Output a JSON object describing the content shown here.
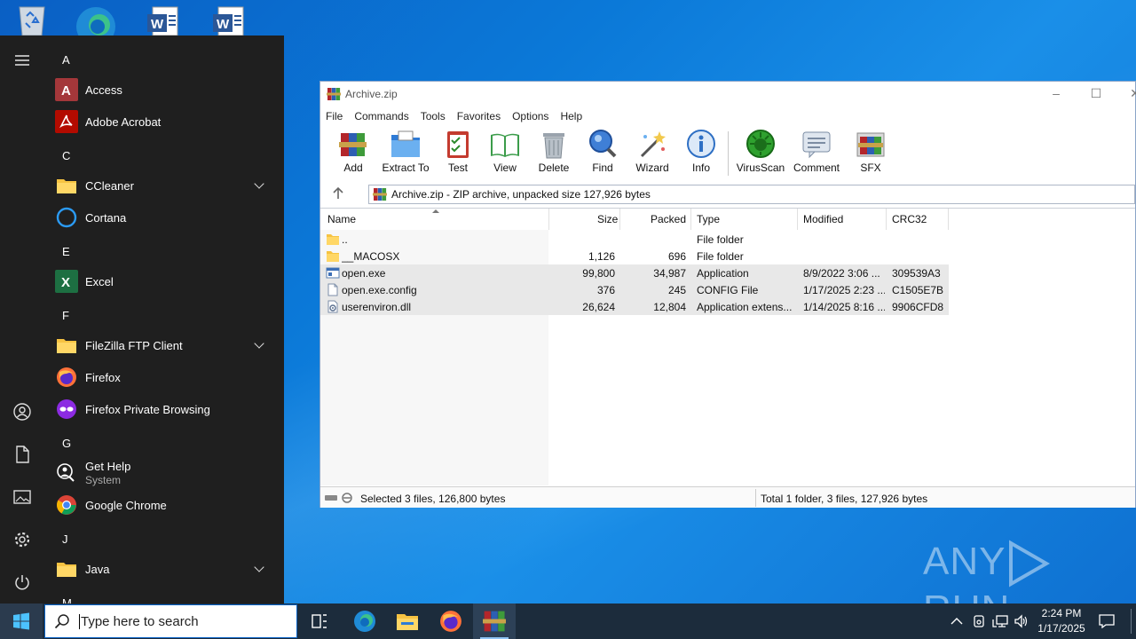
{
  "start_menu": {
    "groups": [
      {
        "letter": "A",
        "apps": [
          {
            "name": "Access",
            "icon": "access-icon"
          },
          {
            "name": "Adobe Acrobat",
            "icon": "acrobat-icon"
          }
        ]
      },
      {
        "letter": "C",
        "apps": [
          {
            "name": "CCleaner",
            "icon": "folder-icon",
            "expandable": true
          },
          {
            "name": "Cortana",
            "icon": "cortana-icon"
          }
        ]
      },
      {
        "letter": "E",
        "apps": [
          {
            "name": "Excel",
            "icon": "excel-icon"
          }
        ]
      },
      {
        "letter": "F",
        "apps": [
          {
            "name": "FileZilla FTP Client",
            "icon": "folder-icon",
            "expandable": true
          },
          {
            "name": "Firefox",
            "icon": "firefox-icon"
          },
          {
            "name": "Firefox Private Browsing",
            "icon": "firefox-private-icon"
          }
        ]
      },
      {
        "letter": "G",
        "apps": [
          {
            "name": "Get Help",
            "sub": "System",
            "icon": "get-help-icon"
          },
          {
            "name": "Google Chrome",
            "icon": "chrome-icon"
          }
        ]
      },
      {
        "letter": "J",
        "apps": [
          {
            "name": "Java",
            "icon": "folder-icon",
            "expandable": true
          }
        ]
      },
      {
        "letter": "M",
        "apps": []
      }
    ]
  },
  "winrar": {
    "title": "Archive.zip",
    "menu": [
      "File",
      "Commands",
      "Tools",
      "Favorites",
      "Options",
      "Help"
    ],
    "toolbar": [
      "Add",
      "Extract To",
      "Test",
      "View",
      "Delete",
      "Find",
      "Wizard",
      "Info",
      "VirusScan",
      "Comment",
      "SFX"
    ],
    "address": "Archive.zip - ZIP archive, unpacked size 127,926 bytes",
    "columns": [
      "Name",
      "Size",
      "Packed",
      "Type",
      "Modified",
      "CRC32"
    ],
    "rows": [
      {
        "name": "..",
        "size": "",
        "packed": "",
        "type": "File folder",
        "modified": "",
        "crc": "",
        "icon": "folder",
        "selected": false
      },
      {
        "name": "__MACOSX",
        "size": "1,126",
        "packed": "696",
        "type": "File folder",
        "modified": "",
        "crc": "",
        "icon": "folder",
        "selected": false
      },
      {
        "name": "open.exe",
        "size": "99,800",
        "packed": "34,987",
        "type": "Application",
        "modified": "8/9/2022 3:06 ...",
        "crc": "309539A3",
        "icon": "exe",
        "selected": true
      },
      {
        "name": "open.exe.config",
        "size": "376",
        "packed": "245",
        "type": "CONFIG File",
        "modified": "1/17/2025 2:23 ...",
        "crc": "C1505E7B",
        "icon": "file",
        "selected": true
      },
      {
        "name": "userenviron.dll",
        "size": "26,624",
        "packed": "12,804",
        "type": "Application extens...",
        "modified": "1/14/2025 8:16 ...",
        "crc": "9906CFD8",
        "icon": "dll",
        "selected": true
      }
    ],
    "status_left": "Selected 3 files, 126,800 bytes",
    "status_right": "Total 1 folder, 3 files, 127,926 bytes"
  },
  "watermark": {
    "left": "ANY",
    "right": "RUN"
  },
  "taskbar": {
    "search_placeholder": "Type here to search",
    "time": "2:24 PM",
    "date": "1/17/2025"
  }
}
